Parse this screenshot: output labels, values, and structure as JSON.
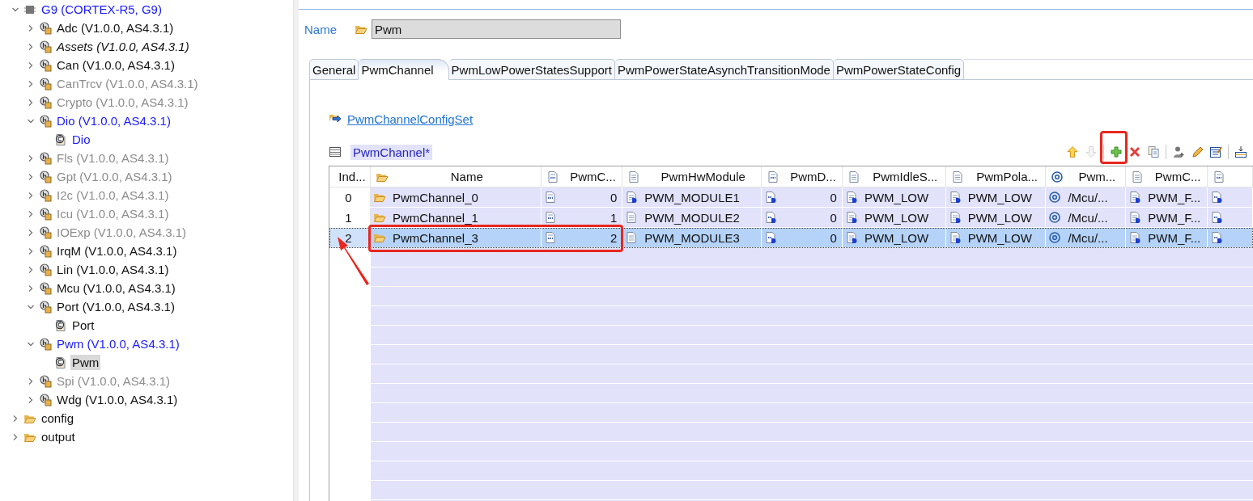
{
  "tree": [
    {
      "label": "G9 (CORTEX-R5, G9)",
      "kind": "device",
      "expanded": true,
      "active": true,
      "disabled": false,
      "italic": false,
      "selected": false,
      "children": [
        {
          "label": "Adc (V1.0.0, AS4.3.1)",
          "kind": "module",
          "expanded": false,
          "active": false,
          "disabled": false,
          "italic": false,
          "selected": false
        },
        {
          "label": "Assets (V1.0.0, AS4.3.1)",
          "kind": "module",
          "expanded": false,
          "active": false,
          "disabled": false,
          "italic": true,
          "selected": false
        },
        {
          "label": "Can (V1.0.0, AS4.3.1)",
          "kind": "module",
          "expanded": false,
          "active": false,
          "disabled": false,
          "italic": false,
          "selected": false
        },
        {
          "label": "CanTrcv (V1.0.0, AS4.3.1)",
          "kind": "module",
          "expanded": false,
          "active": false,
          "disabled": true,
          "italic": false,
          "selected": false
        },
        {
          "label": "Crypto (V1.0.0, AS4.3.1)",
          "kind": "module",
          "expanded": false,
          "active": false,
          "disabled": true,
          "italic": false,
          "selected": false
        },
        {
          "label": "Dio (V1.0.0, AS4.3.1)",
          "kind": "module",
          "expanded": true,
          "active": true,
          "disabled": false,
          "italic": false,
          "selected": false,
          "children": [
            {
              "label": "Dio",
              "kind": "config",
              "active": true,
              "disabled": false,
              "italic": false,
              "selected": false
            }
          ]
        },
        {
          "label": "Fls (V1.0.0, AS4.3.1)",
          "kind": "module",
          "expanded": false,
          "active": false,
          "disabled": true,
          "italic": false,
          "selected": false
        },
        {
          "label": "Gpt (V1.0.0, AS4.3.1)",
          "kind": "module",
          "expanded": false,
          "active": false,
          "disabled": true,
          "italic": false,
          "selected": false
        },
        {
          "label": "I2c (V1.0.0, AS4.3.1)",
          "kind": "module",
          "expanded": false,
          "active": false,
          "disabled": true,
          "italic": false,
          "selected": false
        },
        {
          "label": "Icu (V1.0.0, AS4.3.1)",
          "kind": "module",
          "expanded": false,
          "active": false,
          "disabled": true,
          "italic": false,
          "selected": false
        },
        {
          "label": "IOExp (V1.0.0, AS4.3.1)",
          "kind": "module",
          "expanded": false,
          "active": false,
          "disabled": true,
          "italic": false,
          "selected": false
        },
        {
          "label": "IrqM (V1.0.0, AS4.3.1)",
          "kind": "module",
          "expanded": false,
          "active": false,
          "disabled": false,
          "italic": false,
          "selected": false
        },
        {
          "label": "Lin (V1.0.0, AS4.3.1)",
          "kind": "module",
          "expanded": false,
          "active": false,
          "disabled": false,
          "italic": false,
          "selected": false
        },
        {
          "label": "Mcu (V1.0.0, AS4.3.1)",
          "kind": "module",
          "expanded": false,
          "active": false,
          "disabled": false,
          "italic": false,
          "selected": false
        },
        {
          "label": "Port (V1.0.0, AS4.3.1)",
          "kind": "module",
          "expanded": true,
          "active": false,
          "disabled": false,
          "italic": false,
          "selected": false,
          "children": [
            {
              "label": "Port",
              "kind": "config",
              "active": false,
              "disabled": false,
              "italic": false,
              "selected": false
            }
          ]
        },
        {
          "label": "Pwm (V1.0.0, AS4.3.1)",
          "kind": "module",
          "expanded": true,
          "active": true,
          "disabled": false,
          "italic": false,
          "selected": false,
          "children": [
            {
              "label": "Pwm",
              "kind": "config",
              "active": false,
              "disabled": false,
              "italic": false,
              "selected": true
            }
          ]
        },
        {
          "label": "Spi (V1.0.0, AS4.3.1)",
          "kind": "module",
          "expanded": false,
          "active": false,
          "disabled": true,
          "italic": false,
          "selected": false
        },
        {
          "label": "Wdg (V1.0.0, AS4.3.1)",
          "kind": "module",
          "expanded": false,
          "active": false,
          "disabled": false,
          "italic": false,
          "selected": false
        }
      ]
    },
    {
      "label": "config",
      "kind": "folder",
      "expanded": false,
      "active": false,
      "disabled": false,
      "italic": false,
      "selected": false
    },
    {
      "label": "output",
      "kind": "folder",
      "expanded": false,
      "active": false,
      "disabled": false,
      "italic": false,
      "selected": false
    }
  ],
  "editor": {
    "name_label": "Name",
    "name_value": "Pwm",
    "tabs": [
      {
        "label": "General",
        "selected": false
      },
      {
        "label": "PwmChannel",
        "selected": true
      },
      {
        "label": "PwmLowPowerStatesSupport",
        "selected": false
      },
      {
        "label": "PwmPowerStateAsynchTransitionMode",
        "selected": false
      },
      {
        "label": "PwmPowerStateConfig",
        "selected": false
      }
    ],
    "link": "PwmChannelConfigSet",
    "table_title": "PwmChannel*",
    "toolbar": [
      {
        "kind": "up",
        "disabled": false,
        "annotated": false
      },
      {
        "kind": "down",
        "disabled": true,
        "annotated": false
      },
      {
        "kind": "separator"
      },
      {
        "kind": "add",
        "disabled": false,
        "annotated": true
      },
      {
        "kind": "delete",
        "disabled": false,
        "annotated": false
      },
      {
        "kind": "copy",
        "disabled": false,
        "annotated": false
      },
      {
        "kind": "separator"
      },
      {
        "kind": "person",
        "disabled": false,
        "annotated": false
      },
      {
        "kind": "pencil",
        "disabled": false,
        "annotated": false
      },
      {
        "kind": "edit",
        "disabled": false,
        "annotated": false
      },
      {
        "kind": "separator"
      },
      {
        "kind": "import",
        "disabled": false,
        "annotated": false
      }
    ],
    "table": {
      "columns": [
        {
          "label": "Ind..."
        },
        {
          "label": "Name",
          "kind": "folder"
        },
        {
          "label": "PwmC...",
          "kind": "number"
        },
        {
          "label": "PwmHwModule",
          "kind": "doc"
        },
        {
          "label": "PwmD...",
          "kind": "number"
        },
        {
          "label": "PwmIdleS...",
          "kind": "doc"
        },
        {
          "label": "PwmPola...",
          "kind": "doc"
        },
        {
          "label": "Pwm...",
          "kind": "ref"
        },
        {
          "label": "PwmC...",
          "kind": "doc"
        },
        {
          "kind": "number"
        }
      ],
      "rows": [
        {
          "selected": false,
          "annotated": false,
          "cells": [
            {
              "text": "0"
            },
            {
              "text": "PwmChannel_0",
              "kind": "folder"
            },
            {
              "text": "0",
              "kind": "number"
            },
            {
              "text": "PWM_MODULE1",
              "kind": "enum"
            },
            {
              "text": "0",
              "kind": "number-enum"
            },
            {
              "text": "PWM_LOW",
              "kind": "enum"
            },
            {
              "text": "PWM_LOW",
              "kind": "enum"
            },
            {
              "text": "/Mcu/...",
              "kind": "ref"
            },
            {
              "text": "PWM_F...",
              "kind": "enum"
            },
            {
              "kind": "number-enum"
            }
          ]
        },
        {
          "selected": false,
          "annotated": false,
          "cells": [
            {
              "text": "1"
            },
            {
              "text": "PwmChannel_1",
              "kind": "folder"
            },
            {
              "text": "1",
              "kind": "number"
            },
            {
              "text": "PWM_MODULE2",
              "kind": "doc"
            },
            {
              "text": "0",
              "kind": "number-enum"
            },
            {
              "text": "PWM_LOW",
              "kind": "enum"
            },
            {
              "text": "PWM_LOW",
              "kind": "enum"
            },
            {
              "text": "/Mcu/...",
              "kind": "ref"
            },
            {
              "text": "PWM_F...",
              "kind": "enum"
            },
            {
              "kind": "number-enum"
            }
          ]
        },
        {
          "selected": true,
          "annotated": true,
          "cells": [
            {
              "text": "2"
            },
            {
              "text": "PwmChannel_3",
              "kind": "folder"
            },
            {
              "text": "2",
              "kind": "number"
            },
            {
              "text": "PWM_MODULE3",
              "kind": "doc"
            },
            {
              "text": "0",
              "kind": "number-enum"
            },
            {
              "text": "PWM_LOW",
              "kind": "enum"
            },
            {
              "text": "PWM_LOW",
              "kind": "enum"
            },
            {
              "text": "/Mcu/...",
              "kind": "ref"
            },
            {
              "text": "PWM_F...",
              "kind": "enum"
            },
            {
              "kind": "number-enum"
            }
          ]
        }
      ]
    }
  }
}
